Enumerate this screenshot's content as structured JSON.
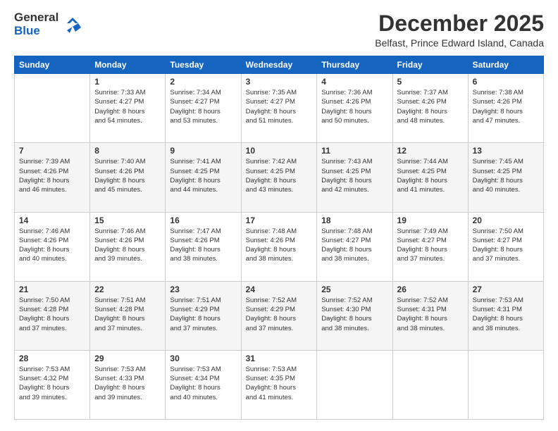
{
  "header": {
    "logo": {
      "line1": "General",
      "line2": "Blue"
    },
    "title": "December 2025",
    "subtitle": "Belfast, Prince Edward Island, Canada"
  },
  "weekdays": [
    "Sunday",
    "Monday",
    "Tuesday",
    "Wednesday",
    "Thursday",
    "Friday",
    "Saturday"
  ],
  "weeks": [
    [
      {
        "day": "",
        "info": ""
      },
      {
        "day": "1",
        "info": "Sunrise: 7:33 AM\nSunset: 4:27 PM\nDaylight: 8 hours\nand 54 minutes."
      },
      {
        "day": "2",
        "info": "Sunrise: 7:34 AM\nSunset: 4:27 PM\nDaylight: 8 hours\nand 53 minutes."
      },
      {
        "day": "3",
        "info": "Sunrise: 7:35 AM\nSunset: 4:27 PM\nDaylight: 8 hours\nand 51 minutes."
      },
      {
        "day": "4",
        "info": "Sunrise: 7:36 AM\nSunset: 4:26 PM\nDaylight: 8 hours\nand 50 minutes."
      },
      {
        "day": "5",
        "info": "Sunrise: 7:37 AM\nSunset: 4:26 PM\nDaylight: 8 hours\nand 48 minutes."
      },
      {
        "day": "6",
        "info": "Sunrise: 7:38 AM\nSunset: 4:26 PM\nDaylight: 8 hours\nand 47 minutes."
      }
    ],
    [
      {
        "day": "7",
        "info": "Sunrise: 7:39 AM\nSunset: 4:26 PM\nDaylight: 8 hours\nand 46 minutes."
      },
      {
        "day": "8",
        "info": "Sunrise: 7:40 AM\nSunset: 4:26 PM\nDaylight: 8 hours\nand 45 minutes."
      },
      {
        "day": "9",
        "info": "Sunrise: 7:41 AM\nSunset: 4:25 PM\nDaylight: 8 hours\nand 44 minutes."
      },
      {
        "day": "10",
        "info": "Sunrise: 7:42 AM\nSunset: 4:25 PM\nDaylight: 8 hours\nand 43 minutes."
      },
      {
        "day": "11",
        "info": "Sunrise: 7:43 AM\nSunset: 4:25 PM\nDaylight: 8 hours\nand 42 minutes."
      },
      {
        "day": "12",
        "info": "Sunrise: 7:44 AM\nSunset: 4:25 PM\nDaylight: 8 hours\nand 41 minutes."
      },
      {
        "day": "13",
        "info": "Sunrise: 7:45 AM\nSunset: 4:25 PM\nDaylight: 8 hours\nand 40 minutes."
      }
    ],
    [
      {
        "day": "14",
        "info": "Sunrise: 7:46 AM\nSunset: 4:26 PM\nDaylight: 8 hours\nand 40 minutes."
      },
      {
        "day": "15",
        "info": "Sunrise: 7:46 AM\nSunset: 4:26 PM\nDaylight: 8 hours\nand 39 minutes."
      },
      {
        "day": "16",
        "info": "Sunrise: 7:47 AM\nSunset: 4:26 PM\nDaylight: 8 hours\nand 38 minutes."
      },
      {
        "day": "17",
        "info": "Sunrise: 7:48 AM\nSunset: 4:26 PM\nDaylight: 8 hours\nand 38 minutes."
      },
      {
        "day": "18",
        "info": "Sunrise: 7:48 AM\nSunset: 4:27 PM\nDaylight: 8 hours\nand 38 minutes."
      },
      {
        "day": "19",
        "info": "Sunrise: 7:49 AM\nSunset: 4:27 PM\nDaylight: 8 hours\nand 37 minutes."
      },
      {
        "day": "20",
        "info": "Sunrise: 7:50 AM\nSunset: 4:27 PM\nDaylight: 8 hours\nand 37 minutes."
      }
    ],
    [
      {
        "day": "21",
        "info": "Sunrise: 7:50 AM\nSunset: 4:28 PM\nDaylight: 8 hours\nand 37 minutes."
      },
      {
        "day": "22",
        "info": "Sunrise: 7:51 AM\nSunset: 4:28 PM\nDaylight: 8 hours\nand 37 minutes."
      },
      {
        "day": "23",
        "info": "Sunrise: 7:51 AM\nSunset: 4:29 PM\nDaylight: 8 hours\nand 37 minutes."
      },
      {
        "day": "24",
        "info": "Sunrise: 7:52 AM\nSunset: 4:29 PM\nDaylight: 8 hours\nand 37 minutes."
      },
      {
        "day": "25",
        "info": "Sunrise: 7:52 AM\nSunset: 4:30 PM\nDaylight: 8 hours\nand 38 minutes."
      },
      {
        "day": "26",
        "info": "Sunrise: 7:52 AM\nSunset: 4:31 PM\nDaylight: 8 hours\nand 38 minutes."
      },
      {
        "day": "27",
        "info": "Sunrise: 7:53 AM\nSunset: 4:31 PM\nDaylight: 8 hours\nand 38 minutes."
      }
    ],
    [
      {
        "day": "28",
        "info": "Sunrise: 7:53 AM\nSunset: 4:32 PM\nDaylight: 8 hours\nand 39 minutes."
      },
      {
        "day": "29",
        "info": "Sunrise: 7:53 AM\nSunset: 4:33 PM\nDaylight: 8 hours\nand 39 minutes."
      },
      {
        "day": "30",
        "info": "Sunrise: 7:53 AM\nSunset: 4:34 PM\nDaylight: 8 hours\nand 40 minutes."
      },
      {
        "day": "31",
        "info": "Sunrise: 7:53 AM\nSunset: 4:35 PM\nDaylight: 8 hours\nand 41 minutes."
      },
      {
        "day": "",
        "info": ""
      },
      {
        "day": "",
        "info": ""
      },
      {
        "day": "",
        "info": ""
      }
    ]
  ]
}
